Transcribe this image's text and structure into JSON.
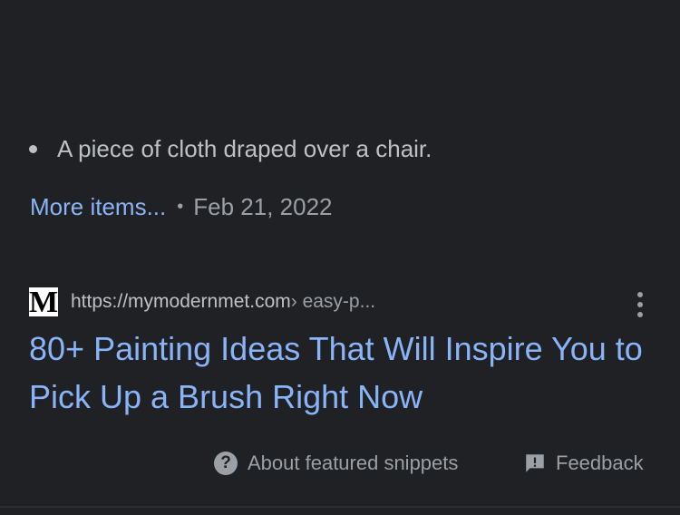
{
  "snippet": {
    "bullet_text": "A piece of cloth draped over a chair.",
    "more_items_label": "More items...",
    "separator": "•",
    "date": "Feb 21, 2022"
  },
  "result": {
    "favicon_letter": "M",
    "url": "https://mymodernmet.com",
    "url_path": " › easy-p...",
    "title": "80+ Painting Ideas That Will Inspire You to Pick Up a Brush Right Now",
    "menu_icon": "more-vert-icon"
  },
  "footer": {
    "about_icon": "help-icon",
    "about_label": "About featured snippets",
    "feedback_icon": "feedback-icon",
    "feedback_label": "Feedback"
  },
  "colors": {
    "background": "#202124",
    "link": "#8ab4f8",
    "text": "#bdc1c6",
    "muted": "#9aa0a6"
  }
}
